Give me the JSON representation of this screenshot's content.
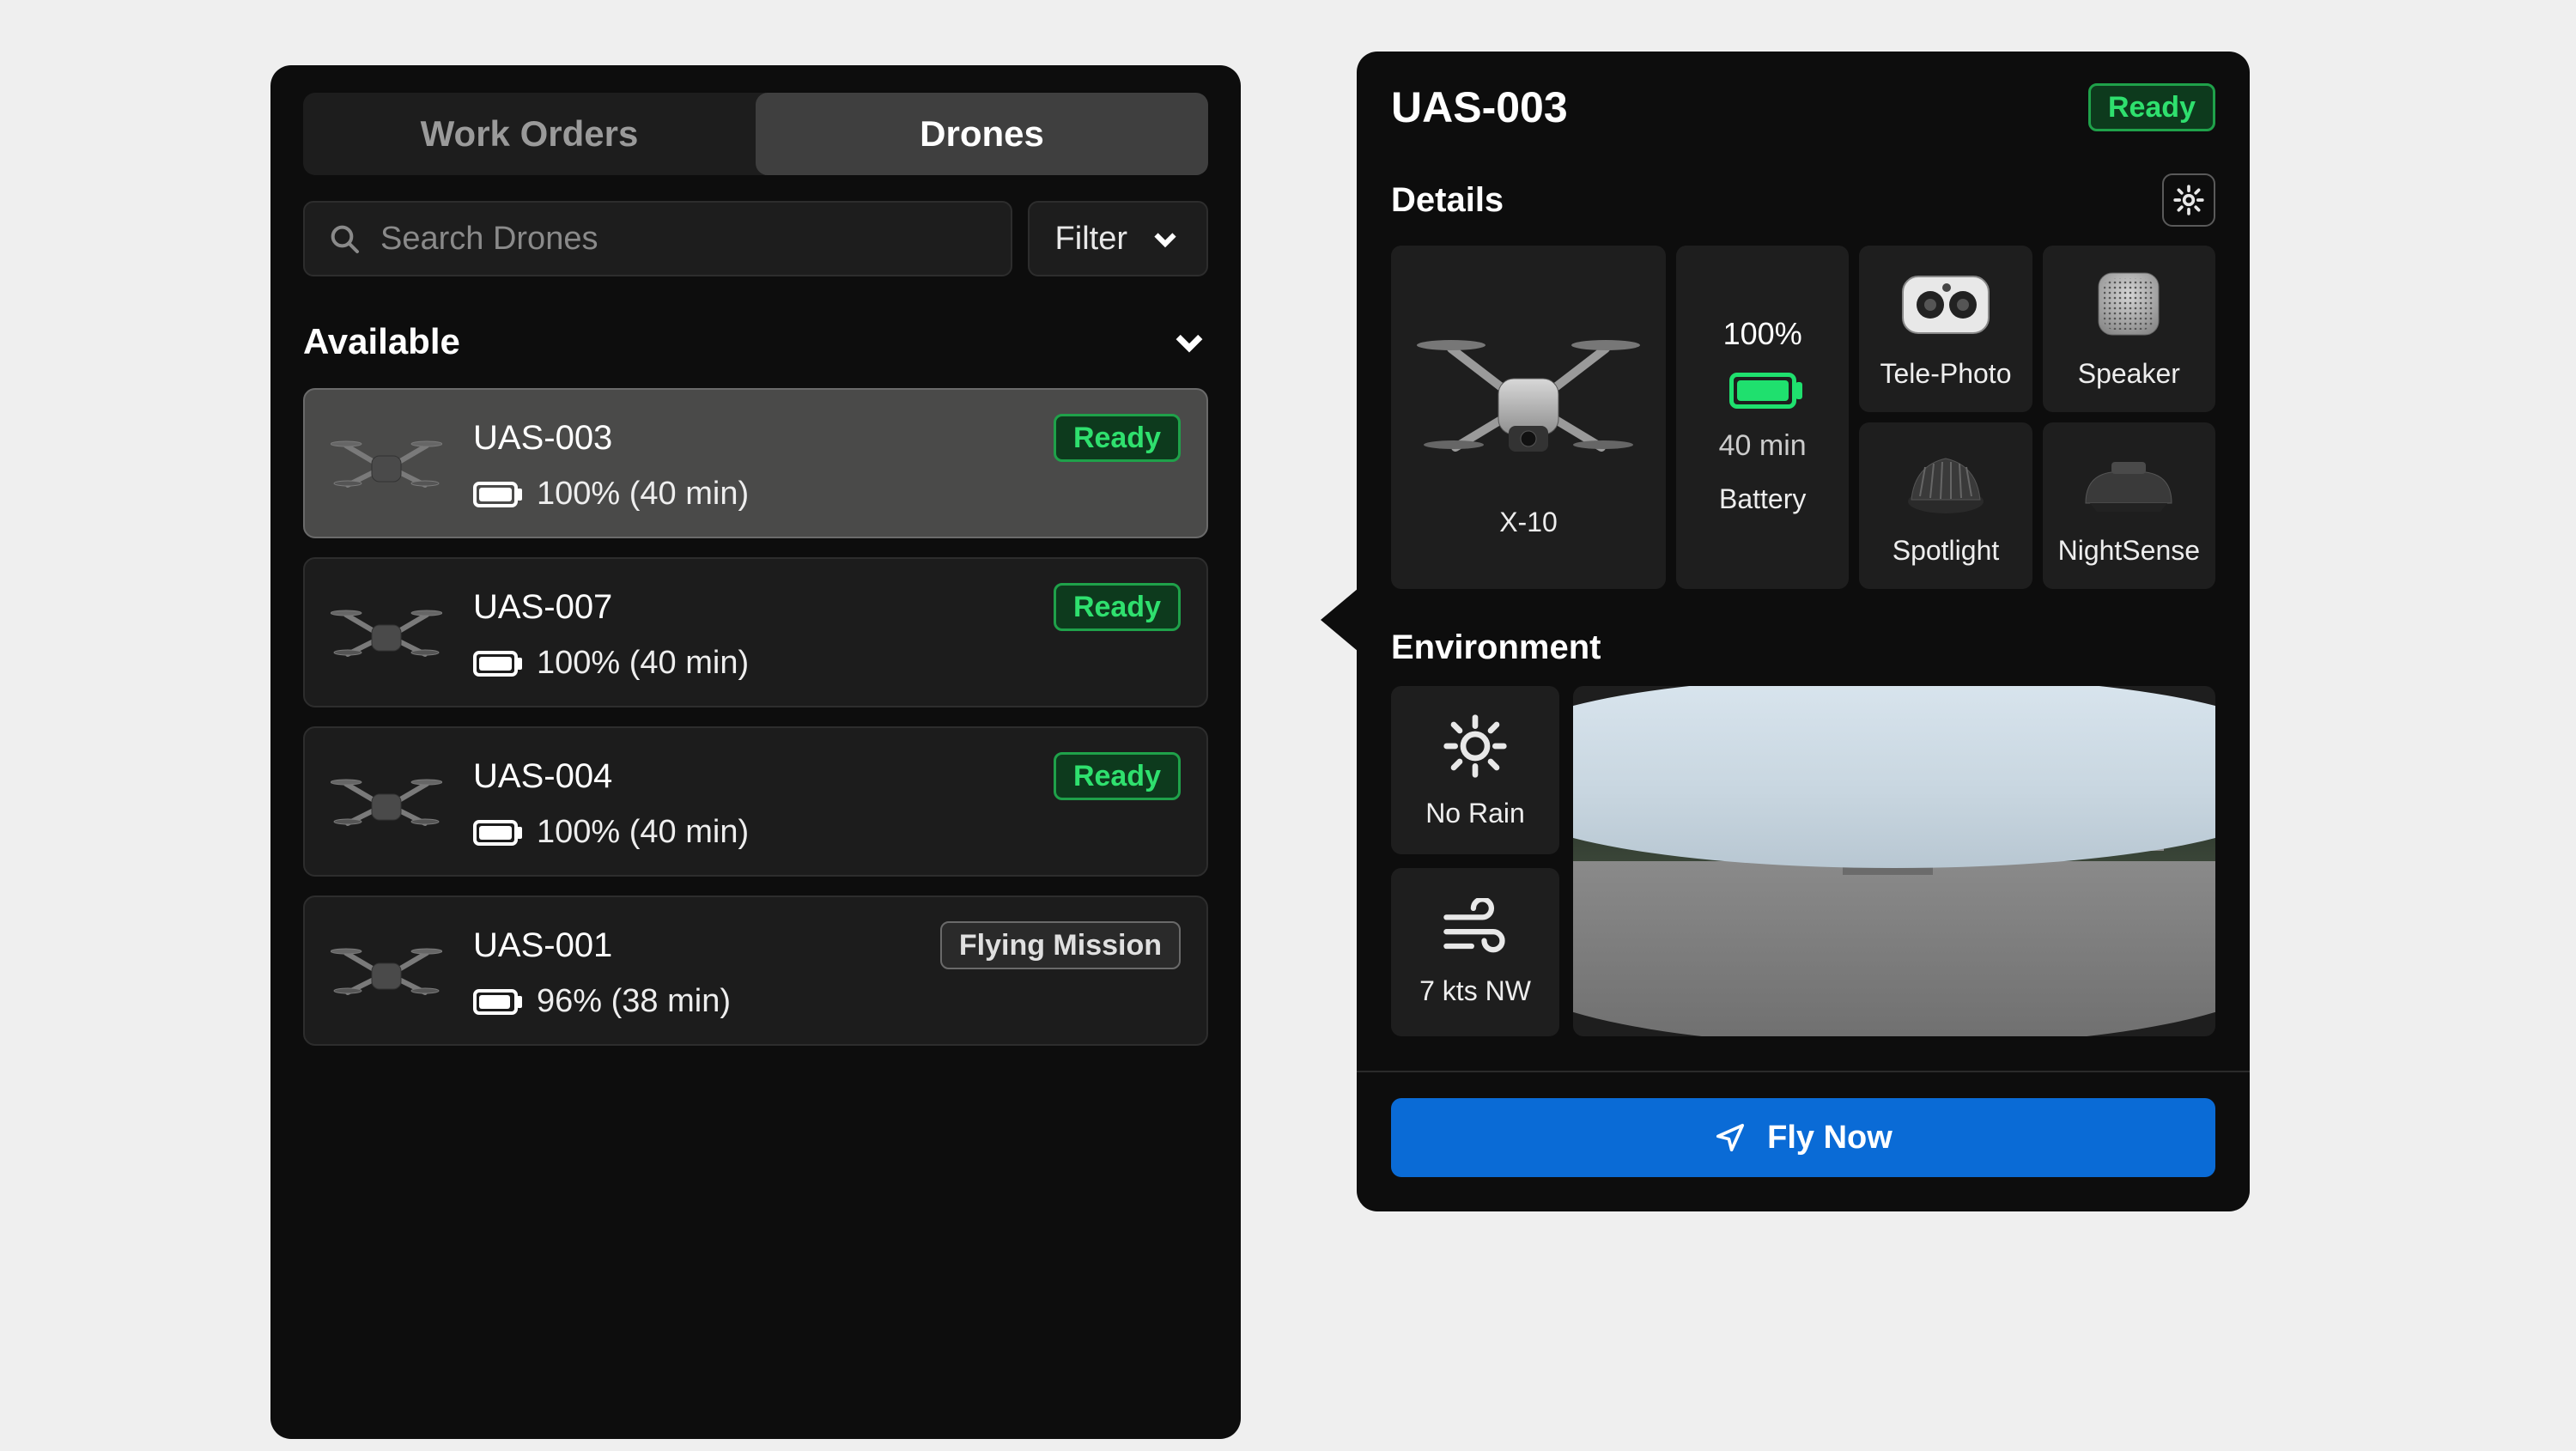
{
  "tabs": {
    "work_orders": "Work Orders",
    "drones": "Drones"
  },
  "search": {
    "placeholder": "Search Drones"
  },
  "filter": {
    "label": "Filter"
  },
  "section": {
    "available": "Available"
  },
  "status": {
    "ready": "Ready",
    "flying": "Flying Mission"
  },
  "drones": [
    {
      "name": "UAS-003",
      "battery_pct": "100%",
      "battery_time": "(40 min)",
      "status": "ready",
      "fill": 100,
      "selected": true
    },
    {
      "name": "UAS-007",
      "battery_pct": "100%",
      "battery_time": "(40 min)",
      "status": "ready",
      "fill": 100,
      "selected": false
    },
    {
      "name": "UAS-004",
      "battery_pct": "100%",
      "battery_time": "(40 min)",
      "status": "ready",
      "fill": 100,
      "selected": false
    },
    {
      "name": "UAS-001",
      "battery_pct": "96%",
      "battery_time": "(38 min)",
      "status": "flying",
      "fill": 96,
      "selected": false
    }
  ],
  "detail": {
    "title": "UAS-003",
    "status": "ready",
    "section_details": "Details",
    "section_env": "Environment",
    "model": "X-10",
    "modules": {
      "telephoto": "Tele-Photo",
      "speaker": "Speaker",
      "spotlight": "Spotlight",
      "nightsense": "NightSense"
    },
    "battery": {
      "label": "Battery",
      "pct": "100%",
      "time": "40 min"
    },
    "env": {
      "rain": "No Rain",
      "wind": "7 kts NW"
    },
    "fly_button": "Fly Now"
  }
}
